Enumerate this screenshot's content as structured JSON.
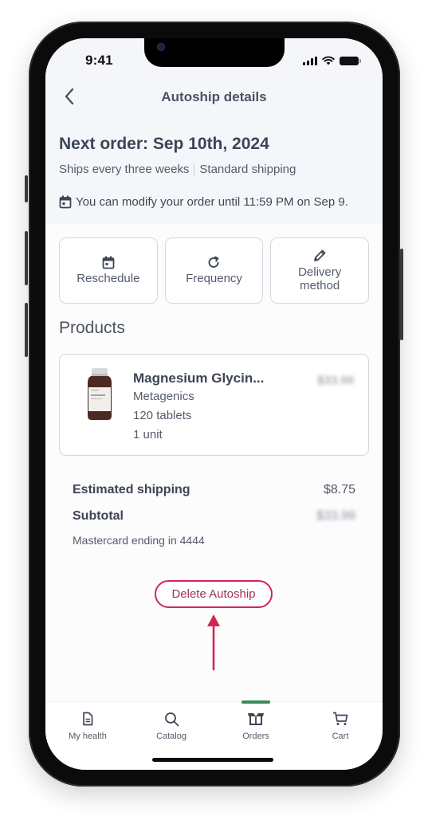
{
  "status_bar": {
    "time": "9:41"
  },
  "nav": {
    "back_icon": "chevron-left-icon",
    "title": "Autoship details"
  },
  "order_info": {
    "next_order": "Next order: Sep 10th, 2024",
    "frequency": "Ships every three weeks",
    "shipping_type": "Standard shipping",
    "modify_icon": "calendar-icon",
    "modify_notice": "You can modify your order until 11:59 PM on Sep 9."
  },
  "actions": [
    {
      "label": "Reschedule",
      "icon": "calendar-icon"
    },
    {
      "label": "Frequency",
      "icon": "refresh-icon"
    },
    {
      "label": "Delivery method",
      "icon": "pencil-icon"
    }
  ],
  "products": {
    "title": "Products",
    "items": [
      {
        "name": "Magnesium Glycin...",
        "brand": "Metagenics",
        "size": "120 tablets",
        "quantity": "1 unit",
        "price": "$33.99",
        "price_blurred": true
      }
    ]
  },
  "summary": {
    "shipping_label": "Estimated shipping",
    "shipping_value": "$8.75",
    "subtotal_label": "Subtotal",
    "subtotal_value": "$33.99",
    "subtotal_blurred": true,
    "payment": "Mastercard ending in 4444"
  },
  "delete_button": {
    "label": "Delete Autoship",
    "border_color": "#d22652",
    "annotation_arrow_color": "#d22652"
  },
  "tabbar": {
    "active": "Orders",
    "active_color": "#3a8a5d",
    "items": [
      {
        "label": "My health",
        "icon": "document-icon"
      },
      {
        "label": "Catalog",
        "icon": "search-icon"
      },
      {
        "label": "Orders",
        "icon": "box-icon"
      },
      {
        "label": "Cart",
        "icon": "cart-icon"
      }
    ]
  }
}
